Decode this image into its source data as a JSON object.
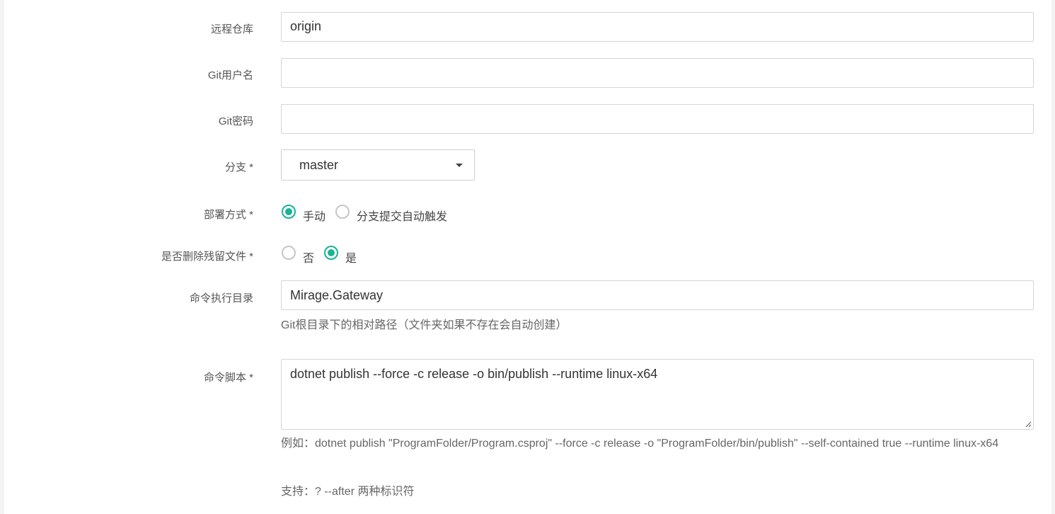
{
  "form": {
    "remote_repo": {
      "label": "远程仓库",
      "value": "origin"
    },
    "git_username": {
      "label": "Git用户名",
      "value": ""
    },
    "git_password": {
      "label": "Git密码",
      "value": ""
    },
    "branch": {
      "label": "分支 *",
      "selected": "master"
    },
    "deploy_mode": {
      "label": "部署方式 *",
      "options": [
        {
          "label": "手动",
          "checked": true
        },
        {
          "label": "分支提交自动触发",
          "checked": false
        }
      ]
    },
    "delete_residual": {
      "label": "是否删除残留文件 *",
      "options": [
        {
          "label": "否",
          "checked": false
        },
        {
          "label": "是",
          "checked": true
        }
      ]
    },
    "work_dir": {
      "label": "命令执行目录",
      "value": "Mirage.Gateway",
      "help": "Git根目录下的相对路径（文件夹如果不存在会自动创建）"
    },
    "script": {
      "label": "命令脚本 *",
      "value": "dotnet publish --force -c release -o bin/publish --runtime linux-x64",
      "help_example": "例如：dotnet publish \"ProgramFolder/Program.csproj\" --force -c release -o \"ProgramFolder/bin/publish\" --self-contained true --runtime linux-x64",
      "help_support": "支持：? --after 两种标识符"
    }
  },
  "colors": {
    "accent": "#1ab394",
    "border": "#d5d5d5",
    "background": "#f3f3f4"
  }
}
